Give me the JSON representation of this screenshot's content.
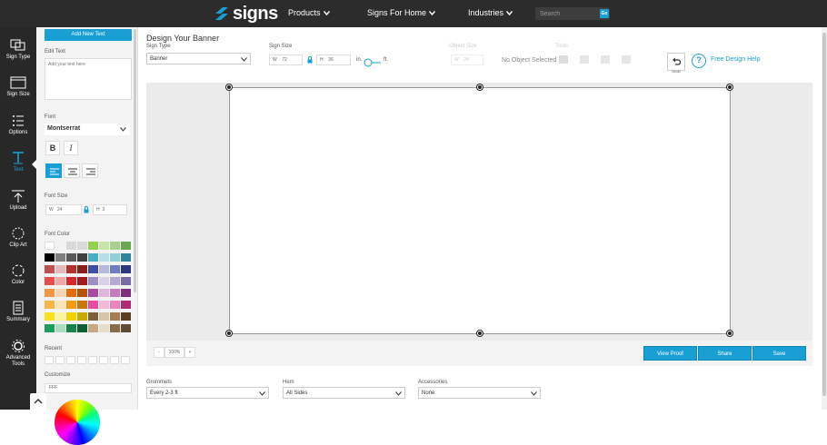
{
  "brand": {
    "name": "signs",
    "sub": ".com"
  },
  "topnav": {
    "products": "Products",
    "signs_for_home": "Signs For Home",
    "industries": "Industries"
  },
  "search": {
    "placeholder": "Search",
    "go": "Go"
  },
  "leftnav": [
    {
      "label": "Sign Type",
      "icon": "sign-type-icon"
    },
    {
      "label": "Sign Size",
      "icon": "sign-size-icon"
    },
    {
      "label": "Options",
      "icon": "options-icon"
    },
    {
      "label": "Text",
      "icon": "text-icon",
      "active": true
    },
    {
      "label": "Upload",
      "icon": "upload-icon"
    },
    {
      "label": "Clip Art",
      "icon": "clip-art-icon"
    },
    {
      "label": "Color",
      "icon": "color-icon"
    },
    {
      "label": "Summary",
      "icon": "summary-icon"
    },
    {
      "label": "Advanced Tools",
      "icon": "advanced-tools-icon"
    }
  ],
  "panel": {
    "add_text": "Add New Text",
    "edit_text_label": "Edit Text",
    "edit_text_placeholder": "Add your text here",
    "font_label": "Font",
    "font_value": "Montserrat",
    "bold": "B",
    "italic": "I",
    "font_size_label": "Font Size",
    "w_label": "W",
    "w_value": "24",
    "h_label": "H",
    "h_value": "3",
    "font_color_label": "Font Color",
    "recent_label": "Recent",
    "customize_label": "Customize",
    "customize_value": "FFF",
    "colors_left": [
      [
        "#ffffff",
        "#f2f2f2",
        "#d9d9d9",
        "#d9d9d9"
      ],
      [
        "#000000",
        "#7f7f7f",
        "#595959",
        "#3f3f3f"
      ],
      [
        "#c0504d",
        "#e6b9b8",
        "#b7312c",
        "#8b1d1a"
      ],
      [
        "#e84d4d",
        "#f4a6a6",
        "#d6272a",
        "#a11b1d"
      ],
      [
        "#f79646",
        "#fbd4b4",
        "#e46c0a",
        "#b7540a"
      ],
      [
        "#f9b64a",
        "#fde2b3",
        "#f29b16",
        "#c9770a"
      ],
      [
        "#f8e31b",
        "#fcf3a0",
        "#f4d000",
        "#c9aa00"
      ],
      [
        "#1e9e5a",
        "#a8ddbd",
        "#16834a",
        "#0e5e35"
      ]
    ],
    "colors_right": [
      [
        "#92d050",
        "#c6e5a8",
        "#a9d18e",
        "#6aa84f"
      ],
      [
        "#4bacc6",
        "#b7dde8",
        "#92cddc",
        "#31849b"
      ],
      [
        "#3d4fa6",
        "#b4badf",
        "#6f7cc3",
        "#2c3880"
      ],
      [
        "#9b8ec4",
        "#d7d1ea",
        "#b5a9d6",
        "#7a6aa8"
      ],
      [
        "#a94ba3",
        "#e1b6de",
        "#c67bbf",
        "#7f2e79"
      ],
      [
        "#e64b9d",
        "#f7b8d8",
        "#ee82bb",
        "#b32a74"
      ],
      [
        "#7f5e3c",
        "#d9c3a6",
        "#a67c52",
        "#5c3f22"
      ],
      [
        "#c8a882",
        "#e9dccb",
        "#8b6a47",
        "#5e4a35"
      ]
    ]
  },
  "main": {
    "title": "Design Your Banner",
    "sign_type_label": "Sign Type",
    "sign_type_value": "Banner",
    "sign_size_label": "Sign Size",
    "width_value": "72",
    "height_value": "36",
    "unit_in": "in.",
    "unit_ft": "ft.",
    "object_size_label": "Object Size",
    "object_w": "24",
    "no_object": "No Object Selected",
    "tools_label": "Tools",
    "undo_label": "Undo",
    "help": "Free Design Help",
    "zoom": "100%",
    "zoom_minus": "-",
    "zoom_plus": "+",
    "view_proof": "View Proof",
    "share": "Share",
    "save": "Save",
    "grommets_label": "Grommets",
    "grommets_value": "Every 2-3 ft",
    "hem_label": "Hem",
    "hem_value": "All Sides",
    "accessories_label": "Accessories",
    "accessories_value": "None"
  }
}
